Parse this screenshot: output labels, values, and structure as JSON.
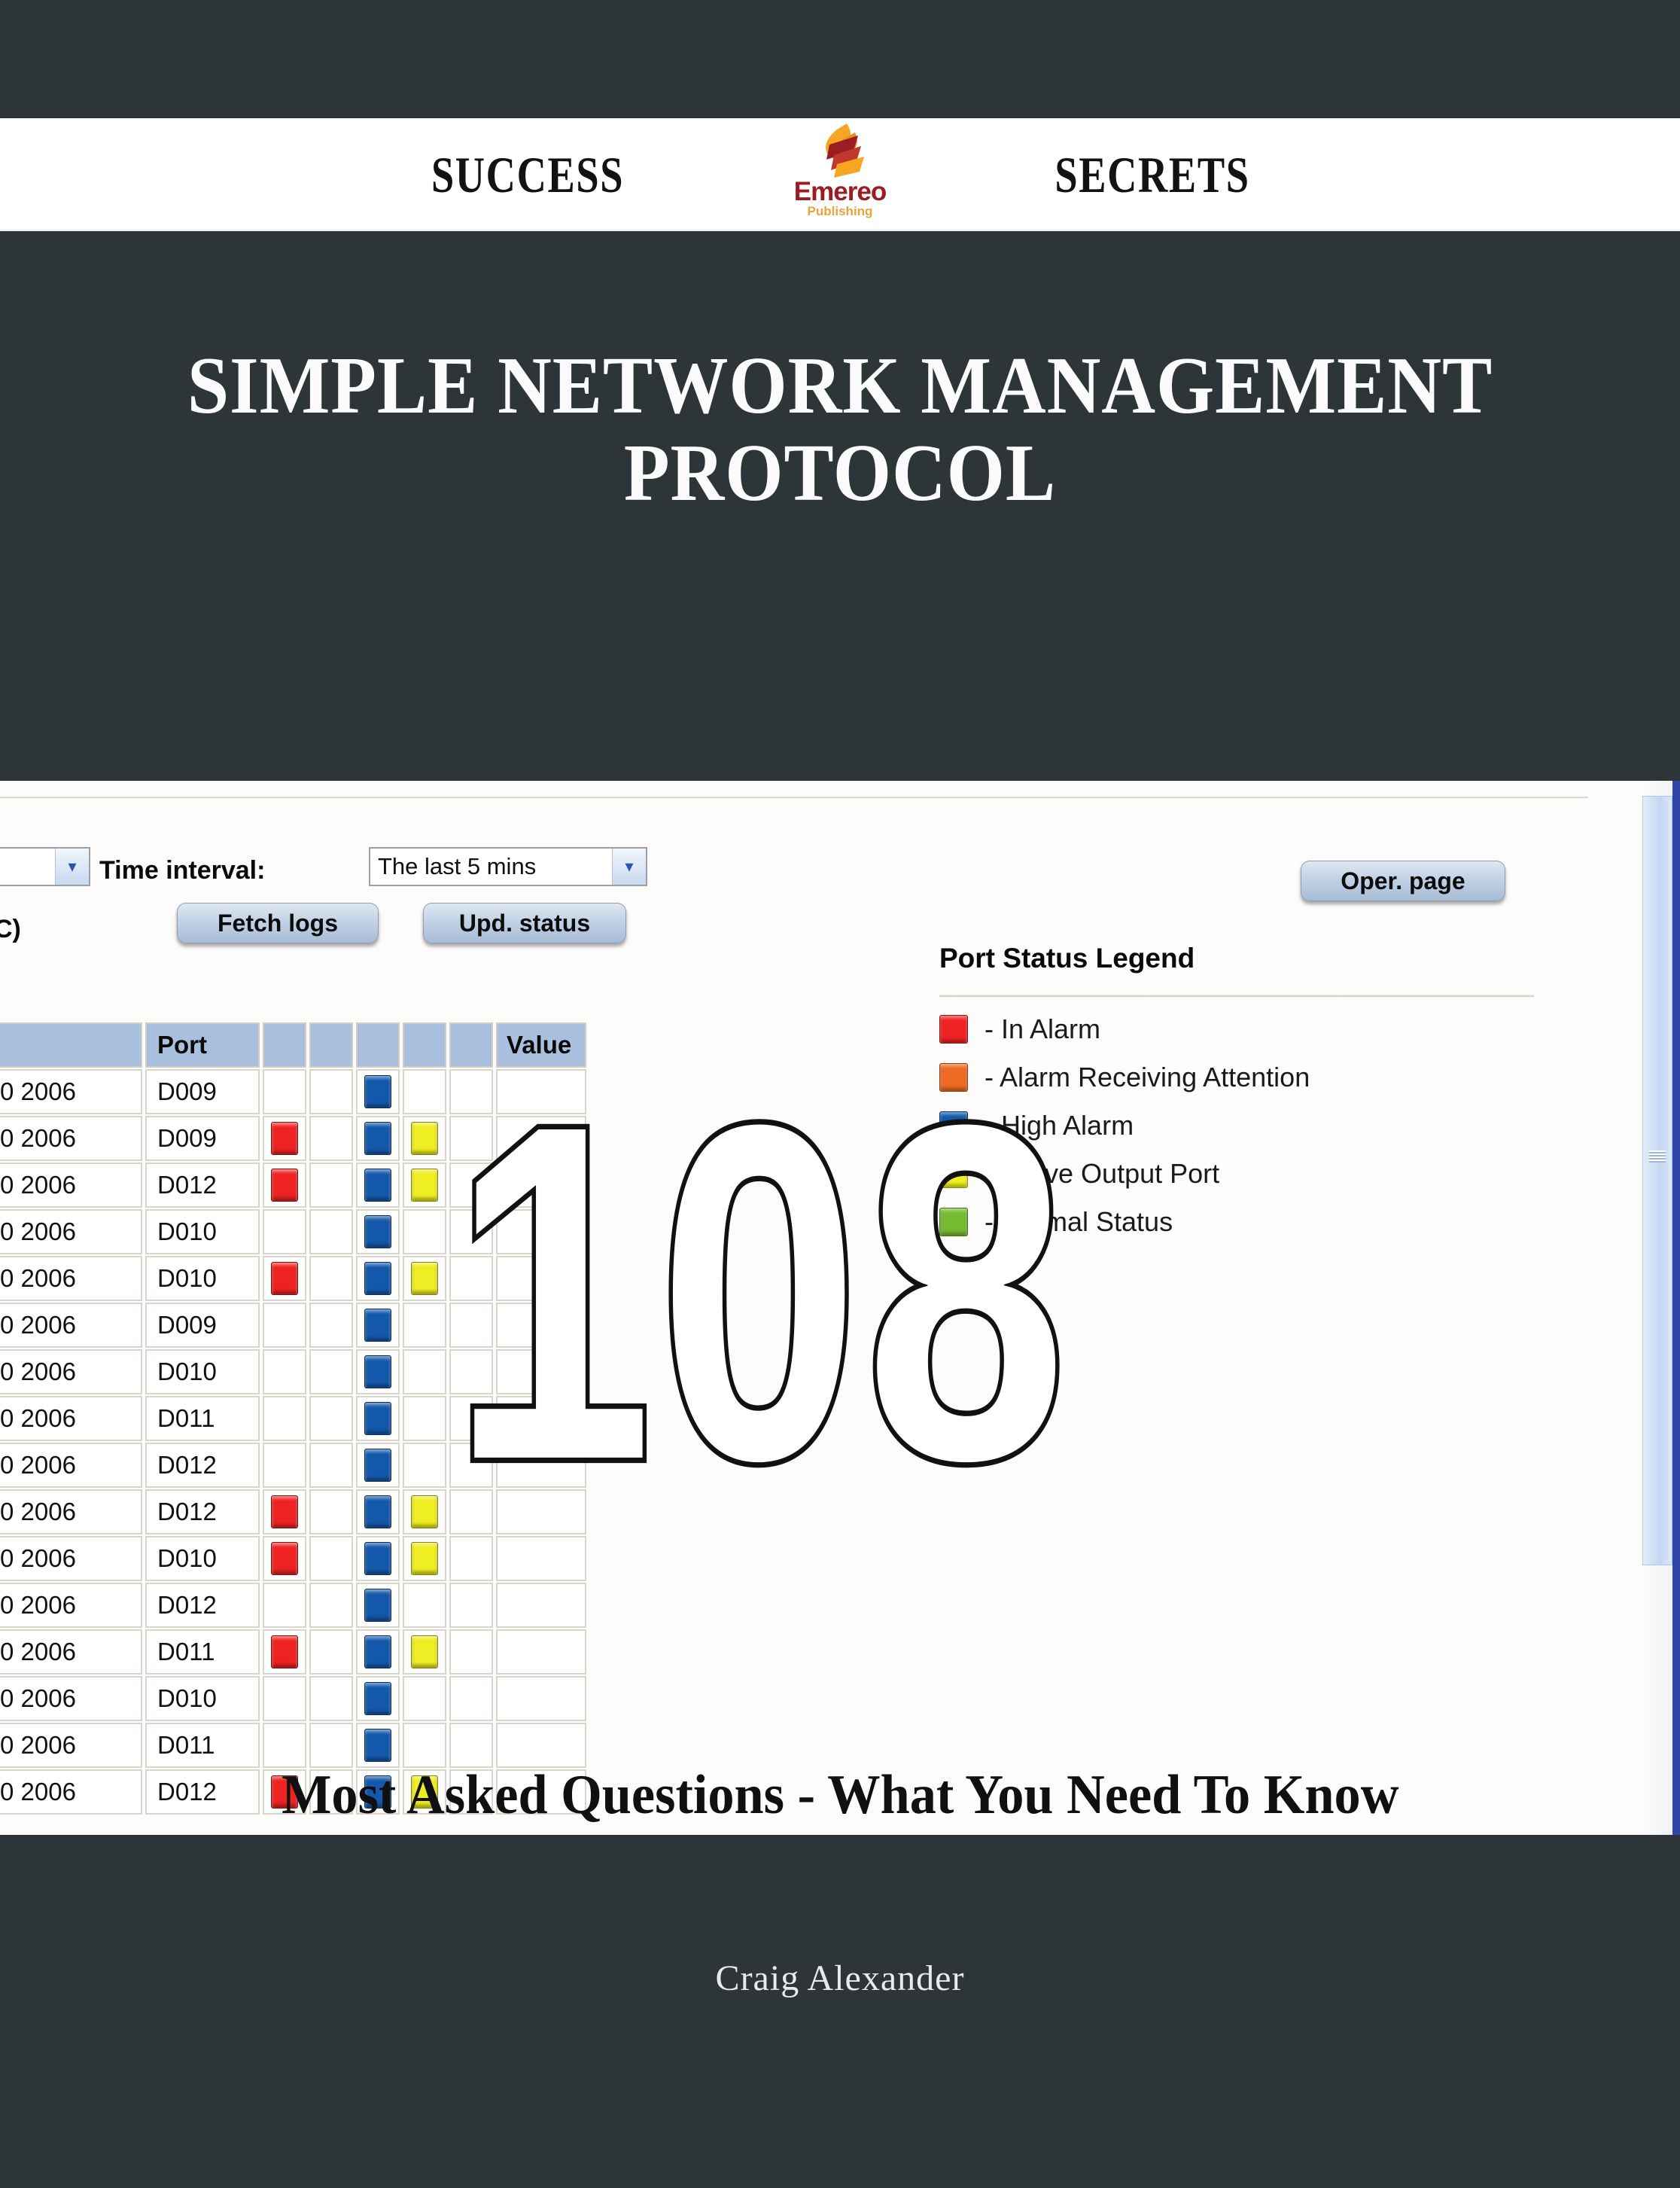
{
  "banner": {
    "left_word": "SUCCESS",
    "right_word": "SECRETS",
    "logo_name": "Emereo",
    "logo_sub": "Publishing"
  },
  "title": {
    "line1": "SIMPLE NETWORK MANAGEMENT",
    "line2": "PROTOCOL"
  },
  "subtitle": "Most Asked Questions - What You Need To Know",
  "author": "Craig Alexander",
  "overlay_number": "108",
  "screenshot": {
    "toolbar": {
      "time_interval_label": "Time interval:",
      "time_interval_value": "The last 5 mins",
      "left_select_value": "",
      "clipped_text": "C)",
      "fetch_logs_label": "Fetch logs",
      "upd_status_label": "Upd. status",
      "oper_page_label": "Oper. page"
    },
    "table": {
      "headers": [
        "",
        "Port",
        "",
        "",
        "",
        "",
        "",
        "Value"
      ],
      "rows": [
        {
          "date": "0 2006",
          "port": "D009",
          "s1": "",
          "s2": "",
          "s3": "blue",
          "s4": "",
          "s5": "",
          "value": ""
        },
        {
          "date": "0 2006",
          "port": "D009",
          "s1": "red",
          "s2": "",
          "s3": "blue",
          "s4": "yellow",
          "s5": "",
          "value": ""
        },
        {
          "date": "0 2006",
          "port": "D012",
          "s1": "red",
          "s2": "",
          "s3": "blue",
          "s4": "yellow",
          "s5": "",
          "value": ""
        },
        {
          "date": "0 2006",
          "port": "D010",
          "s1": "",
          "s2": "",
          "s3": "blue",
          "s4": "",
          "s5": "",
          "value": ""
        },
        {
          "date": "0 2006",
          "port": "D010",
          "s1": "red",
          "s2": "",
          "s3": "blue",
          "s4": "yellow",
          "s5": "",
          "value": ""
        },
        {
          "date": "0 2006",
          "port": "D009",
          "s1": "",
          "s2": "",
          "s3": "blue",
          "s4": "",
          "s5": "",
          "value": ""
        },
        {
          "date": "0 2006",
          "port": "D010",
          "s1": "",
          "s2": "",
          "s3": "blue",
          "s4": "",
          "s5": "",
          "value": ""
        },
        {
          "date": "0 2006",
          "port": "D011",
          "s1": "",
          "s2": "",
          "s3": "blue",
          "s4": "",
          "s5": "",
          "value": ""
        },
        {
          "date": "0 2006",
          "port": "D012",
          "s1": "",
          "s2": "",
          "s3": "blue",
          "s4": "",
          "s5": "",
          "value": ""
        },
        {
          "date": "0 2006",
          "port": "D012",
          "s1": "red",
          "s2": "",
          "s3": "blue",
          "s4": "yellow",
          "s5": "",
          "value": ""
        },
        {
          "date": "0 2006",
          "port": "D010",
          "s1": "red",
          "s2": "",
          "s3": "blue",
          "s4": "yellow",
          "s5": "",
          "value": ""
        },
        {
          "date": "0 2006",
          "port": "D012",
          "s1": "",
          "s2": "",
          "s3": "blue",
          "s4": "",
          "s5": "",
          "value": ""
        },
        {
          "date": "0 2006",
          "port": "D011",
          "s1": "red",
          "s2": "",
          "s3": "blue",
          "s4": "yellow",
          "s5": "",
          "value": ""
        },
        {
          "date": "0 2006",
          "port": "D010",
          "s1": "",
          "s2": "",
          "s3": "blue",
          "s4": "",
          "s5": "",
          "value": ""
        },
        {
          "date": "0 2006",
          "port": "D011",
          "s1": "",
          "s2": "",
          "s3": "blue",
          "s4": "",
          "s5": "",
          "value": ""
        },
        {
          "date": "0 2006",
          "port": "D012",
          "s1": "red",
          "s2": "",
          "s3": "blue",
          "s4": "yellow",
          "s5": "",
          "value": ""
        }
      ]
    },
    "legend": {
      "title": "Port Status Legend",
      "items": [
        {
          "color": "red",
          "hex": "#ee2222",
          "label": "- In Alarm"
        },
        {
          "color": "orange",
          "hex": "#ee6a22",
          "label": "- Alarm Receiving Attention"
        },
        {
          "color": "blue",
          "hex": "#1458ab",
          "label": "- High Alarm"
        },
        {
          "color": "yellow",
          "hex": "#eeee22",
          "label": "- Active Output Port"
        },
        {
          "color": "green",
          "hex": "#77bb33",
          "label": "- Normal Status"
        }
      ]
    }
  },
  "colors": {
    "cover_background": "#2e3539",
    "banner_background": "#ffffff",
    "title_text": "#fbfbfb",
    "logo_red": "#9c1c24",
    "logo_orange": "#e8a33a",
    "chip_red": "#ee2222",
    "chip_orange": "#ee6a22",
    "chip_blue": "#1458ab",
    "chip_yellow": "#eeee22",
    "chip_green": "#77bb33",
    "grid_header": "#a8c0dd"
  }
}
